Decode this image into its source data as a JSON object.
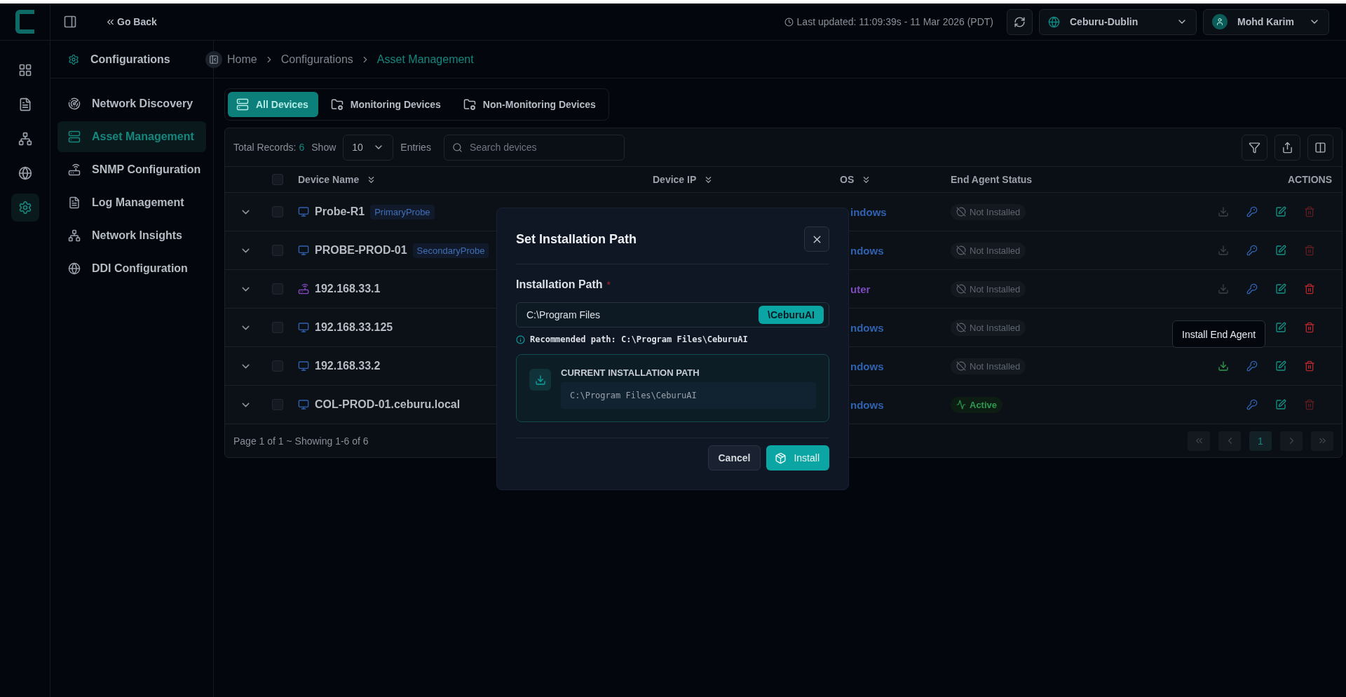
{
  "topbar": {
    "go_back": "Go Back",
    "last_updated": "Last updated: 11:09:39s - 11 Mar 2026 (PDT)",
    "location": "Ceburu-Dublin",
    "user": "Mohd Karim"
  },
  "rail": [
    {
      "kind": "dashboard",
      "selected": false
    },
    {
      "kind": "document",
      "selected": false
    },
    {
      "kind": "network",
      "selected": false
    },
    {
      "kind": "globe",
      "selected": false
    },
    {
      "kind": "settings",
      "selected": true
    }
  ],
  "sidebar": {
    "title": "Configurations",
    "items": [
      {
        "label": "Network Discovery",
        "kind": "radar",
        "selected": false
      },
      {
        "label": "Asset Management",
        "kind": "server",
        "selected": true
      },
      {
        "label": "SNMP Configuration",
        "kind": "router",
        "selected": false
      },
      {
        "label": "Log Management",
        "kind": "document",
        "selected": false
      },
      {
        "label": "Network Insights",
        "kind": "network",
        "selected": false
      },
      {
        "label": "DDI Configuration",
        "kind": "globe",
        "selected": false
      }
    ]
  },
  "breadcrumb": [
    "Home",
    "Configurations",
    "Asset Management"
  ],
  "tabs": [
    {
      "label": "All Devices",
      "kind": "server",
      "selected": true
    },
    {
      "label": "Monitoring Devices",
      "kind": "folder",
      "selected": false
    },
    {
      "label": "Non-Monitoring Devices",
      "kind": "folder",
      "selected": false
    }
  ],
  "table": {
    "total_label": "Total Records:",
    "total": "6",
    "show_label": "Show",
    "page_size": "10",
    "entries_label": "Entries",
    "search_placeholder": "Search devices",
    "all_checked": false,
    "columns": [
      {
        "label": "Device Name",
        "sortable": true
      },
      {
        "label": "Device IP",
        "sortable": true
      },
      {
        "label": "OS",
        "sortable": true
      },
      {
        "label": "End Agent Status",
        "sortable": false
      },
      {
        "label": "ACTIONS",
        "sortable": false
      }
    ],
    "rows": [
      {
        "name": "Probe-R1",
        "tag": "PrimaryProbe",
        "checked": false,
        "device": {
          "kind": "monitor"
        },
        "os": {
          "text": "indows",
          "color": "#2f62b0"
        },
        "status": {
          "kind": "not_installed",
          "label": "Not Installed"
        },
        "actions": [
          {
            "kind": "download",
            "disabled": true
          },
          {
            "kind": "key",
            "disabled": false
          },
          {
            "kind": "edit",
            "disabled": false
          },
          {
            "kind": "delete",
            "disabled": true
          }
        ]
      },
      {
        "name": "PROBE-PROD-01",
        "tag": "SecondaryProbe",
        "checked": false,
        "device": {
          "kind": "monitor"
        },
        "os": {
          "text": "ndows",
          "color": "#2f62b0"
        },
        "status": {
          "kind": "not_installed",
          "label": "Not Installed"
        },
        "actions": [
          {
            "kind": "download",
            "disabled": true
          },
          {
            "kind": "key",
            "disabled": false
          },
          {
            "kind": "edit",
            "disabled": false
          },
          {
            "kind": "delete",
            "disabled": true
          }
        ]
      },
      {
        "name": "192.168.33.1",
        "checked": false,
        "device": {
          "kind": "router"
        },
        "os": {
          "text": "uter",
          "color": "#7c4bbd"
        },
        "status": {
          "kind": "not_installed",
          "label": "Not Installed"
        },
        "actions": [
          {
            "kind": "download",
            "disabled": true
          },
          {
            "kind": "key",
            "disabled": false
          },
          {
            "kind": "edit",
            "disabled": false
          },
          {
            "kind": "delete",
            "disabled": false
          }
        ]
      },
      {
        "name": "192.168.33.125",
        "checked": false,
        "device": {
          "kind": "monitor"
        },
        "os": {
          "text": "ndows",
          "color": "#2f62b0"
        },
        "status": {
          "kind": "not_installed",
          "label": "Not Installed"
        },
        "actions": [
          {
            "kind": "edit",
            "disabled": false
          },
          {
            "kind": "delete",
            "disabled": false
          }
        ]
      },
      {
        "name": "192.168.33.2",
        "checked": false,
        "device": {
          "kind": "monitor"
        },
        "os": {
          "text": "ndows",
          "color": "#2f62b0"
        },
        "status": {
          "kind": "not_installed",
          "label": "Not Installed"
        },
        "actions": [
          {
            "kind": "download",
            "disabled": false
          },
          {
            "kind": "key",
            "disabled": false
          },
          {
            "kind": "edit",
            "disabled": false
          },
          {
            "kind": "delete",
            "disabled": false
          }
        ]
      },
      {
        "name": "COL-PROD-01.ceburu.local",
        "checked": false,
        "device": {
          "kind": "monitor"
        },
        "os": {
          "text": "ndows",
          "color": "#2f62b0"
        },
        "status": {
          "kind": "active",
          "label": "Active"
        },
        "actions": [
          {
            "kind": "key",
            "disabled": false
          },
          {
            "kind": "edit",
            "disabled": false
          },
          {
            "kind": "delete",
            "disabled": true
          }
        ]
      }
    ],
    "footer": "Page 1 of 1 ~ Showing 1-6 of 6",
    "pages": [
      {
        "label": "1",
        "selected": true
      }
    ]
  },
  "tooltip": "Install End Agent",
  "modal": {
    "title": "Set Installation Path",
    "field_label": "Installation Path",
    "required_mark": "*",
    "value": "C:\\Program Files",
    "suffix": "\\CeburuAI",
    "hint": "Recommended path: C:\\Program Files\\CeburuAI",
    "current_title": "CURRENT INSTALLATION PATH",
    "current_path": "C:\\Program Files\\CeburuAI",
    "cancel": "Cancel",
    "install": "Install"
  }
}
